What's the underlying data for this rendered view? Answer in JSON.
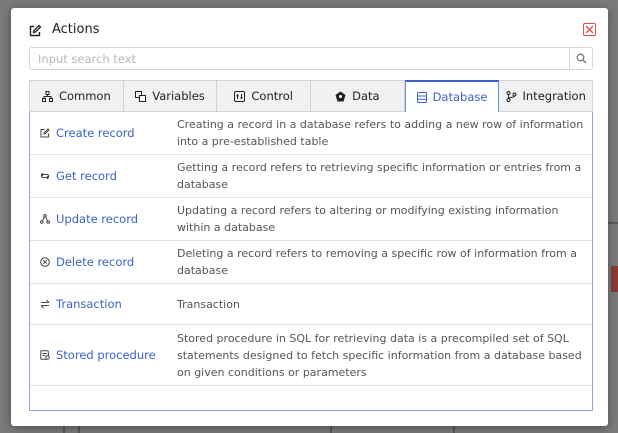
{
  "dialog": {
    "title": "Actions",
    "search": {
      "placeholder": "Input search text",
      "value": ""
    }
  },
  "tabs": [
    {
      "label": "Common",
      "icon": "sitemap-icon",
      "active": false
    },
    {
      "label": "Variables",
      "icon": "variables-icon",
      "active": false
    },
    {
      "label": "Control",
      "icon": "control-icon",
      "active": false
    },
    {
      "label": "Data",
      "icon": "data-icon",
      "active": false
    },
    {
      "label": "Database",
      "icon": "database-icon",
      "active": true
    },
    {
      "label": "Integration",
      "icon": "integration-icon",
      "active": false
    }
  ],
  "actions": [
    {
      "name": "Create record",
      "icon": "edit-icon",
      "description": "Creating a record in a database refers to adding a new row of information into a pre-established table"
    },
    {
      "name": "Get record",
      "icon": "get-record-icon",
      "description": "Getting a record refers to retrieving specific information or entries from a database"
    },
    {
      "name": "Update record",
      "icon": "update-record-icon",
      "description": "Updating a record refers to altering or modifying existing information within a database"
    },
    {
      "name": "Delete record",
      "icon": "delete-record-icon",
      "description": "Deleting a record refers to removing a specific row of information from a database"
    },
    {
      "name": "Transaction",
      "icon": "transaction-icon",
      "description": "Transaction"
    },
    {
      "name": "Stored procedure",
      "icon": "stored-procedure-icon",
      "description": "Stored procedure in SQL for retrieving data is a precompiled set of SQL statements designed to fetch specific information from a database based on given conditions or parameters"
    }
  ],
  "colors": {
    "accent": "#3a62c8",
    "close": "#d9534f"
  }
}
